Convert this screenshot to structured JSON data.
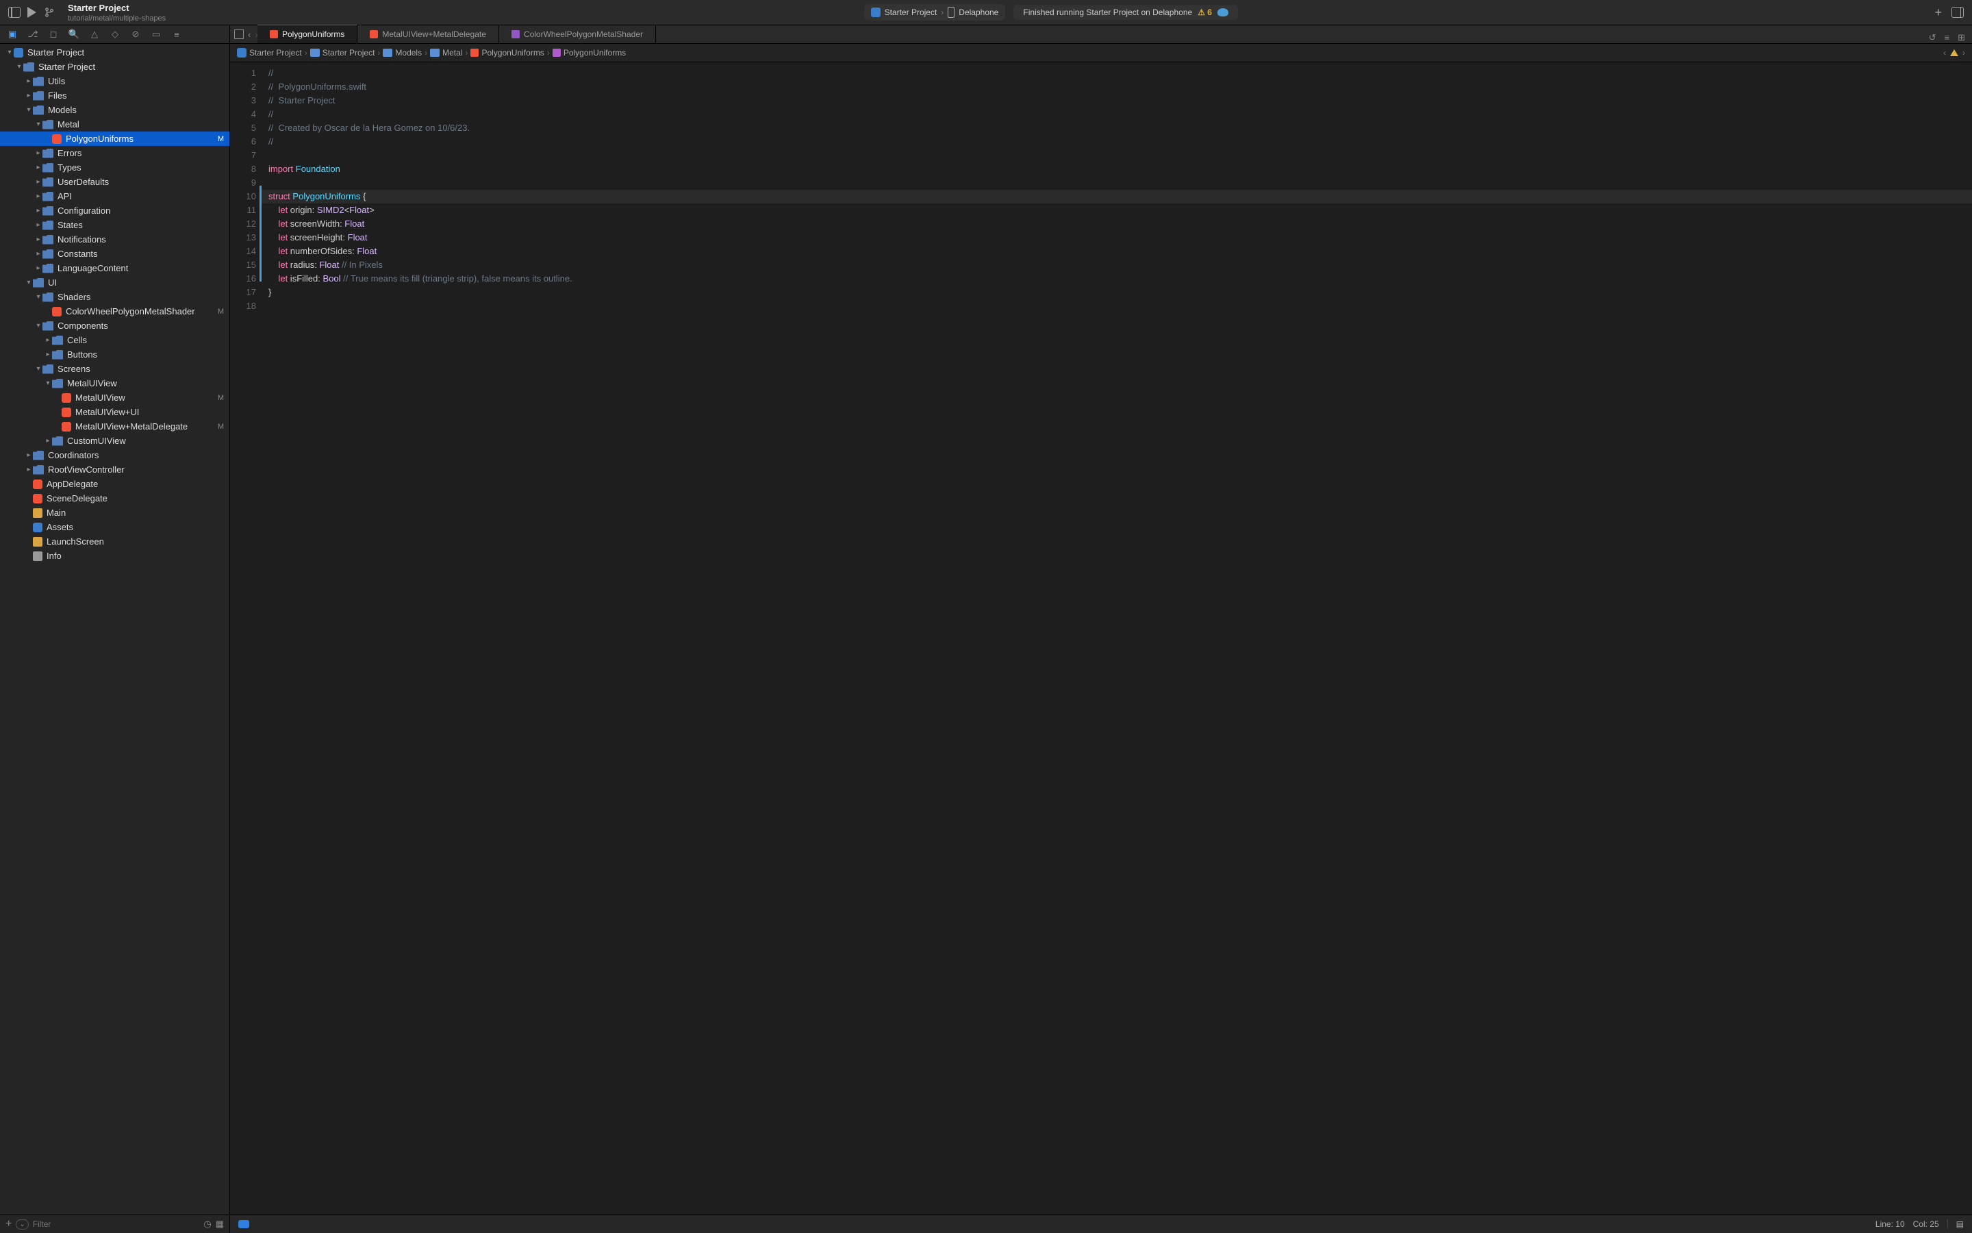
{
  "toolbar": {
    "project_title": "Starter Project",
    "project_subtitle": "tutorial/metal/multiple-shapes",
    "scheme": "Starter Project",
    "device": "Delaphone",
    "status": "Finished running Starter Project on Delaphone",
    "warning_count": "6"
  },
  "tabs": [
    {
      "label": "PolygonUniforms",
      "kind": "swift",
      "active": true
    },
    {
      "label": "MetalUIView+MetalDelegate",
      "kind": "swift",
      "active": false
    },
    {
      "label": "ColorWheelPolygonMetalShader",
      "kind": "shader",
      "active": false
    }
  ],
  "jumpbar": {
    "crumbs": [
      "Starter Project",
      "Starter Project",
      "Models",
      "Metal",
      "PolygonUniforms",
      "PolygonUniforms"
    ]
  },
  "filetree": [
    {
      "d": 0,
      "k": "app",
      "open": true,
      "l": "Starter Project"
    },
    {
      "d": 1,
      "k": "fldr",
      "open": true,
      "l": "Starter Project"
    },
    {
      "d": 2,
      "k": "fldr",
      "open": false,
      "l": "Utils",
      "hasChildren": true
    },
    {
      "d": 2,
      "k": "fldr",
      "open": false,
      "l": "Files",
      "hasChildren": true
    },
    {
      "d": 2,
      "k": "fldr",
      "open": true,
      "l": "Models"
    },
    {
      "d": 3,
      "k": "fldr",
      "open": true,
      "l": "Metal"
    },
    {
      "d": 4,
      "k": "swift",
      "l": "PolygonUniforms",
      "scm": "M",
      "selected": true
    },
    {
      "d": 3,
      "k": "fldr",
      "open": false,
      "l": "Errors",
      "hasChildren": true
    },
    {
      "d": 3,
      "k": "fldr",
      "open": false,
      "l": "Types",
      "hasChildren": true
    },
    {
      "d": 3,
      "k": "fldr",
      "open": false,
      "l": "UserDefaults",
      "hasChildren": true
    },
    {
      "d": 3,
      "k": "fldr",
      "open": false,
      "l": "API",
      "hasChildren": true
    },
    {
      "d": 3,
      "k": "fldr",
      "open": false,
      "l": "Configuration",
      "hasChildren": true
    },
    {
      "d": 3,
      "k": "fldr",
      "open": false,
      "l": "States",
      "hasChildren": true
    },
    {
      "d": 3,
      "k": "fldr",
      "open": false,
      "l": "Notifications",
      "hasChildren": true
    },
    {
      "d": 3,
      "k": "fldr",
      "open": false,
      "l": "Constants",
      "hasChildren": true
    },
    {
      "d": 3,
      "k": "fldr",
      "open": false,
      "l": "LanguageContent",
      "hasChildren": true
    },
    {
      "d": 2,
      "k": "fldr",
      "open": true,
      "l": "UI"
    },
    {
      "d": 3,
      "k": "fldr",
      "open": true,
      "l": "Shaders"
    },
    {
      "d": 4,
      "k": "swift",
      "l": "ColorWheelPolygonMetalShader",
      "scm": "M"
    },
    {
      "d": 3,
      "k": "fldr",
      "open": true,
      "l": "Components"
    },
    {
      "d": 4,
      "k": "fldr",
      "open": false,
      "l": "Cells",
      "hasChildren": true
    },
    {
      "d": 4,
      "k": "fldr",
      "open": false,
      "l": "Buttons",
      "hasChildren": true
    },
    {
      "d": 3,
      "k": "fldr",
      "open": true,
      "l": "Screens"
    },
    {
      "d": 4,
      "k": "fldr",
      "open": true,
      "l": "MetalUIView"
    },
    {
      "d": 5,
      "k": "swift",
      "l": "MetalUIView",
      "scm": "M"
    },
    {
      "d": 5,
      "k": "swift",
      "l": "MetalUIView+UI"
    },
    {
      "d": 5,
      "k": "swift",
      "l": "MetalUIView+MetalDelegate",
      "scm": "M"
    },
    {
      "d": 4,
      "k": "fldr",
      "open": false,
      "l": "CustomUIView",
      "hasChildren": true
    },
    {
      "d": 2,
      "k": "fldr",
      "open": false,
      "l": "Coordinators",
      "hasChildren": true
    },
    {
      "d": 2,
      "k": "fldr",
      "open": false,
      "l": "RootViewController",
      "hasChildren": true
    },
    {
      "d": 2,
      "k": "swift",
      "l": "AppDelegate"
    },
    {
      "d": 2,
      "k": "swift",
      "l": "SceneDelegate"
    },
    {
      "d": 2,
      "k": "xib",
      "l": "Main"
    },
    {
      "d": 2,
      "k": "assets",
      "l": "Assets"
    },
    {
      "d": 2,
      "k": "xib",
      "l": "LaunchScreen"
    },
    {
      "d": 2,
      "k": "plist",
      "l": "Info"
    }
  ],
  "filter": {
    "placeholder": "Filter"
  },
  "code": {
    "lines": [
      {
        "n": 1,
        "seg": [
          [
            "cm",
            "//"
          ]
        ]
      },
      {
        "n": 2,
        "seg": [
          [
            "cm",
            "//  PolygonUniforms.swift"
          ]
        ]
      },
      {
        "n": 3,
        "seg": [
          [
            "cm",
            "//  Starter Project"
          ]
        ]
      },
      {
        "n": 4,
        "seg": [
          [
            "cm",
            "//"
          ]
        ]
      },
      {
        "n": 5,
        "seg": [
          [
            "cm",
            "//  Created by Oscar de la Hera Gomez on 10/6/23."
          ]
        ]
      },
      {
        "n": 6,
        "seg": [
          [
            "cm",
            "//"
          ]
        ]
      },
      {
        "n": 7,
        "seg": [
          [
            "id",
            ""
          ]
        ]
      },
      {
        "n": 8,
        "seg": [
          [
            "kw",
            "import"
          ],
          [
            "id",
            " "
          ],
          [
            "cl",
            "Foundation"
          ]
        ]
      },
      {
        "n": 9,
        "seg": [
          [
            "id",
            ""
          ]
        ]
      },
      {
        "n": 10,
        "hl": true,
        "seg": [
          [
            "kw",
            "struct"
          ],
          [
            "id",
            " "
          ],
          [
            "cl",
            "PolygonUniforms"
          ],
          [
            "id",
            " {"
          ]
        ]
      },
      {
        "n": 11,
        "seg": [
          [
            "id",
            "    "
          ],
          [
            "kw",
            "let"
          ],
          [
            "id",
            " origin: "
          ],
          [
            "ty",
            "SIMD2"
          ],
          [
            "id",
            "<"
          ],
          [
            "ty",
            "Float"
          ],
          [
            "id",
            ">"
          ]
        ]
      },
      {
        "n": 12,
        "seg": [
          [
            "id",
            "    "
          ],
          [
            "kw",
            "let"
          ],
          [
            "id",
            " screenWidth: "
          ],
          [
            "ty",
            "Float"
          ]
        ]
      },
      {
        "n": 13,
        "seg": [
          [
            "id",
            "    "
          ],
          [
            "kw",
            "let"
          ],
          [
            "id",
            " screenHeight: "
          ],
          [
            "ty",
            "Float"
          ]
        ]
      },
      {
        "n": 14,
        "seg": [
          [
            "id",
            "    "
          ],
          [
            "kw",
            "let"
          ],
          [
            "id",
            " numberOfSides: "
          ],
          [
            "ty",
            "Float"
          ]
        ]
      },
      {
        "n": 15,
        "seg": [
          [
            "id",
            "    "
          ],
          [
            "kw",
            "let"
          ],
          [
            "id",
            " radius: "
          ],
          [
            "ty",
            "Float"
          ],
          [
            "id",
            " "
          ],
          [
            "cm",
            "// In Pixels"
          ]
        ]
      },
      {
        "n": 16,
        "seg": [
          [
            "id",
            "    "
          ],
          [
            "kw",
            "let"
          ],
          [
            "id",
            " isFilled: "
          ],
          [
            "ty",
            "Bool"
          ],
          [
            "id",
            " "
          ],
          [
            "cm",
            "// True means its fill (triangle strip), false means its outline."
          ]
        ]
      },
      {
        "n": 17,
        "seg": [
          [
            "id",
            "}"
          ]
        ]
      },
      {
        "n": 18,
        "seg": [
          [
            "id",
            ""
          ]
        ]
      }
    ]
  },
  "statusbar": {
    "line": "Line: 10",
    "col": "Col: 25"
  }
}
